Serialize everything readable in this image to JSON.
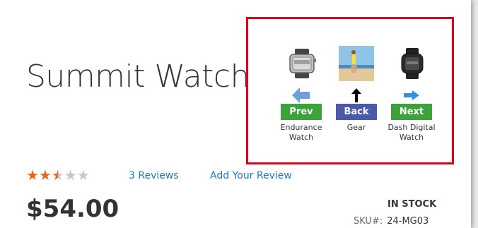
{
  "product": {
    "title": "Summit Watch",
    "rating_fraction": 0.5,
    "stars_total": 5,
    "reviews_link": "3 Reviews",
    "add_review_link": "Add Your Review",
    "price": "$54.00",
    "stock_status": "IN STOCK",
    "sku_label": "SKU#:",
    "sku_value": "24-MG03"
  },
  "navigation": {
    "prev": {
      "button": "Prev",
      "label": "Endurance Watch",
      "icon": "left-arrow-icon"
    },
    "back": {
      "button": "Back",
      "label": "Gear",
      "icon": "up-arrow-icon"
    },
    "next": {
      "button": "Next",
      "label": "Dash Digital Watch",
      "icon": "right-arrow-icon"
    }
  },
  "colors": {
    "highlight_border": "#e3001b",
    "prev_next_button": "#3aa339",
    "back_button": "#4a5aa8",
    "link": "#1979c3",
    "star_filled": "#e46a1d",
    "star_empty": "#c7c7c7"
  }
}
